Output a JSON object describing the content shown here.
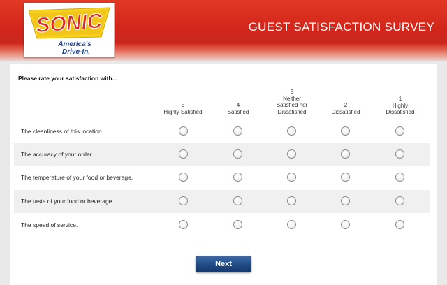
{
  "brand": {
    "logo_text": "SONIC",
    "tagline_1": "America's",
    "tagline_2": "Drive-In."
  },
  "header": {
    "title": "GUEST SATISFACTION SURVEY"
  },
  "survey": {
    "prompt": "Please rate your satisfaction with...",
    "columns": [
      {
        "num": "5",
        "l1": "Highly Satisfied",
        "l2": ""
      },
      {
        "num": "4",
        "l1": "Satisfied",
        "l2": ""
      },
      {
        "num": "3",
        "l1": "Neither",
        "l2": "Satisfied nor",
        "l3": "Dissatisfied"
      },
      {
        "num": "2",
        "l1": "Dissatisfied",
        "l2": ""
      },
      {
        "num": "1",
        "l1": "Highly",
        "l2": "Dissatisfied"
      }
    ],
    "questions": [
      {
        "label": "The cleanliness of this location."
      },
      {
        "label": "The accuracy of your order."
      },
      {
        "label": "The temperature of your food or beverage."
      },
      {
        "label": "The taste of your food or beverage."
      },
      {
        "label": "The speed of service."
      }
    ],
    "next_label": "Next"
  },
  "colors": {
    "header_red": "#d3261a",
    "logo_yellow": "#f6d21c",
    "logo_red": "#e0281c",
    "button_blue": "#1f4a86"
  }
}
